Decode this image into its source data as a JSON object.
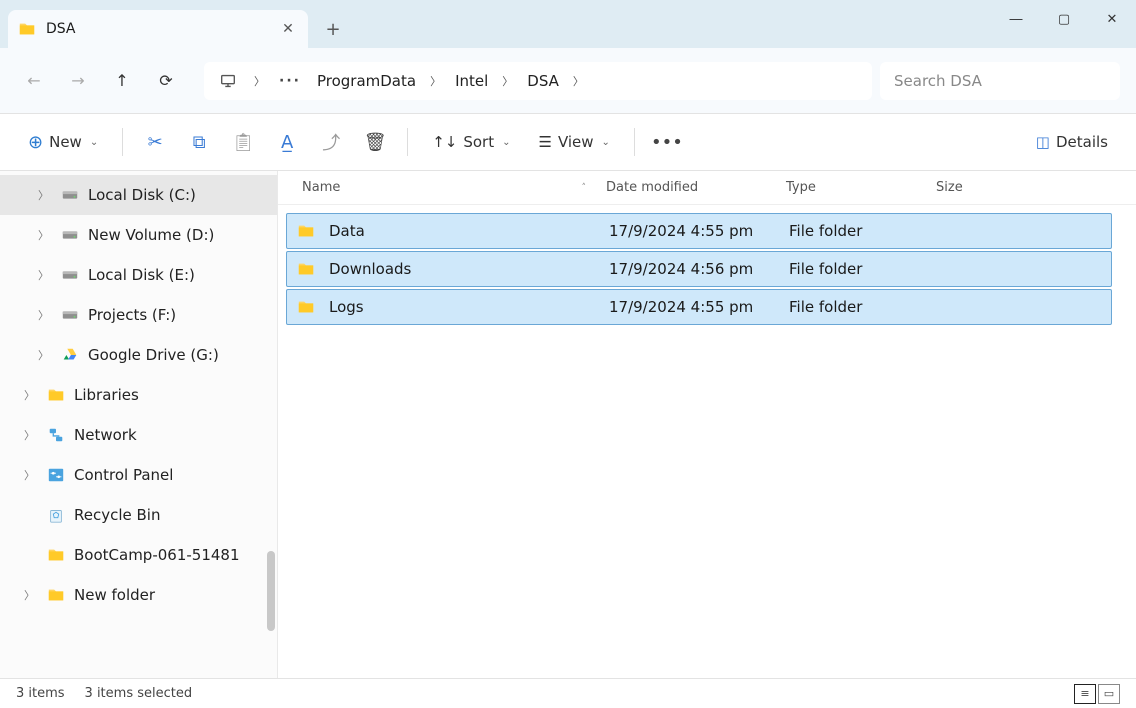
{
  "tab": {
    "title": "DSA"
  },
  "breadcrumbs": [
    "ProgramData",
    "Intel",
    "DSA"
  ],
  "search": {
    "placeholder": "Search DSA"
  },
  "toolbar": {
    "new": "New",
    "sort": "Sort",
    "view": "View",
    "details": "Details"
  },
  "columns": {
    "name": "Name",
    "date": "Date modified",
    "type": "Type",
    "size": "Size"
  },
  "nav": {
    "items": [
      {
        "label": "Local Disk (C:)",
        "icon": "disk",
        "selected": true,
        "arrow": true,
        "indent": true
      },
      {
        "label": "New Volume (D:)",
        "icon": "disk",
        "arrow": true,
        "indent": true
      },
      {
        "label": "Local Disk (E:)",
        "icon": "disk",
        "arrow": true,
        "indent": true
      },
      {
        "label": "Projects (F:)",
        "icon": "disk",
        "arrow": true,
        "indent": true
      },
      {
        "label": "Google Drive (G:)",
        "icon": "gdrive",
        "arrow": true,
        "indent": true
      },
      {
        "label": "Libraries",
        "icon": "folder",
        "arrow": true
      },
      {
        "label": "Network",
        "icon": "network",
        "arrow": true
      },
      {
        "label": "Control Panel",
        "icon": "control",
        "arrow": true
      },
      {
        "label": "Recycle Bin",
        "icon": "recycle",
        "arrow": false
      },
      {
        "label": "BootCamp-061-51481",
        "icon": "folder",
        "arrow": false
      },
      {
        "label": "New folder",
        "icon": "folder",
        "arrow": true
      }
    ]
  },
  "rows": [
    {
      "name": "Data",
      "date": "17/9/2024 4:55 pm",
      "type": "File folder"
    },
    {
      "name": "Downloads",
      "date": "17/9/2024 4:56 pm",
      "type": "File folder"
    },
    {
      "name": "Logs",
      "date": "17/9/2024 4:55 pm",
      "type": "File folder"
    }
  ],
  "status": {
    "count": "3 items",
    "selected": "3 items selected"
  }
}
